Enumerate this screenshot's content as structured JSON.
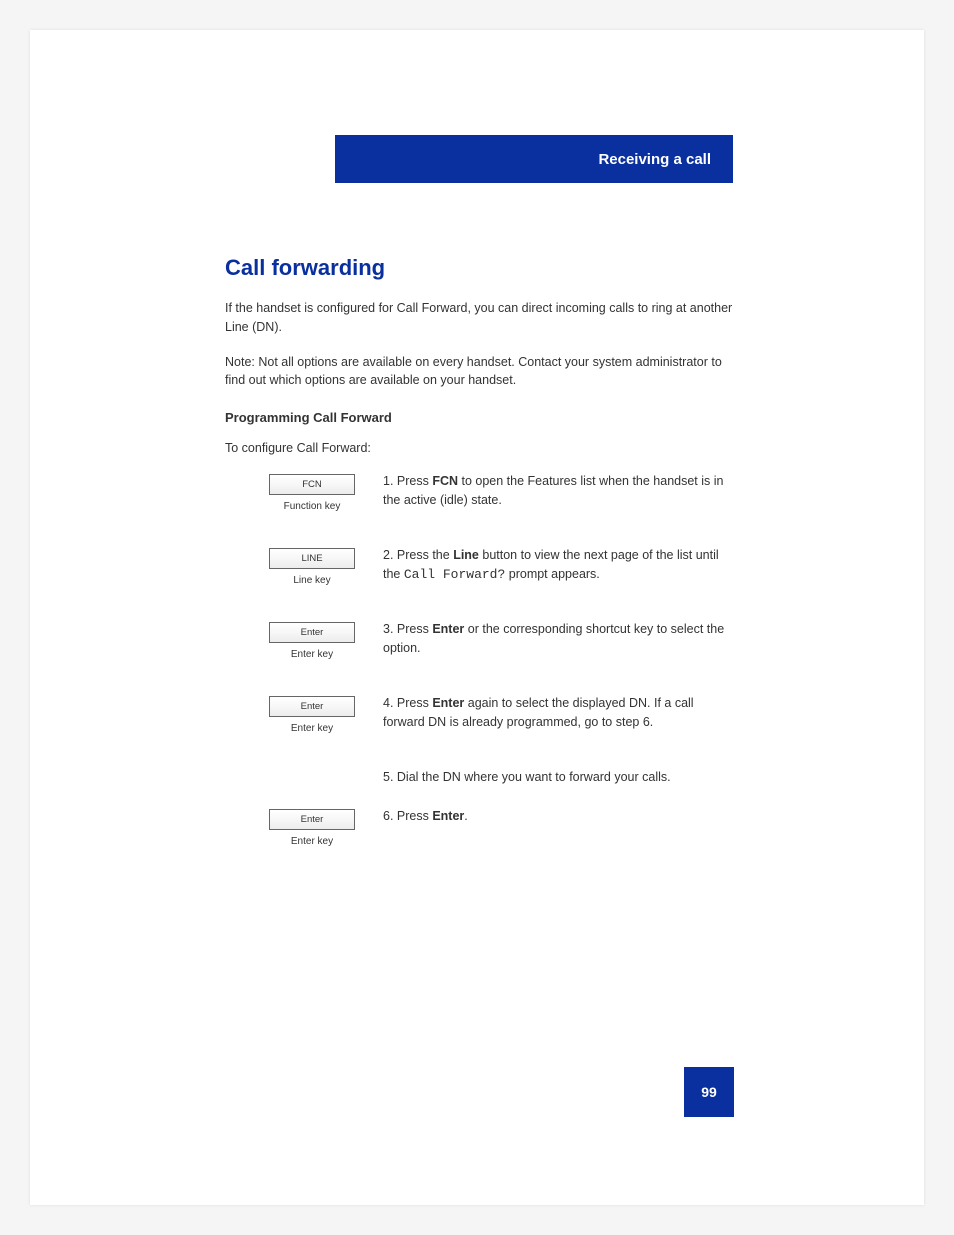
{
  "header": {
    "section": "Receiving a call"
  },
  "content": {
    "title": "Call forwarding",
    "intro": "If the handset is configured for Call Forward, you can direct incoming calls to ring at another Line (DN).",
    "note": "Note: Not all options are available on every handset. Contact your system administrator to find out which options are available on your handset.",
    "subsection": "Programming Call Forward",
    "sub_intro": "To configure Call Forward:",
    "steps": [
      {
        "button": "FCN",
        "key_label": "Function key",
        "text_prefix": "1. Press ",
        "text_bold": "FCN",
        "text_after": " to open the Features list when the handset is in the active (idle) state."
      },
      {
        "button": "LINE",
        "key_label": "Line key",
        "text_prefix": "2. Press the ",
        "text_bold": "Line",
        "text_after": " button to view the next page of the list until the ",
        "mono": "Call Forward?",
        "text_after2": " prompt appears."
      },
      {
        "button": "Enter",
        "key_label": "Enter key",
        "text_prefix": "3. Press ",
        "text_bold": "Enter",
        "text_after": " or the corresponding shortcut key to select the option."
      },
      {
        "button": "Enter",
        "key_label": "Enter key",
        "text_prefix": "4. Press ",
        "text_bold": "Enter",
        "text_after": " again to select the displayed DN. If a call forward DN is already programmed, go to step 6."
      },
      {
        "button": "",
        "key_label": "",
        "no_button": true,
        "text_prefix": "5. Dial the DN where you want to forward your calls.",
        "text_bold": "",
        "text_after": ""
      },
      {
        "button": "Enter",
        "key_label": "Enter key",
        "text_prefix": "6. Press ",
        "text_bold": "Enter",
        "text_after": "."
      }
    ]
  },
  "page_number": "99"
}
